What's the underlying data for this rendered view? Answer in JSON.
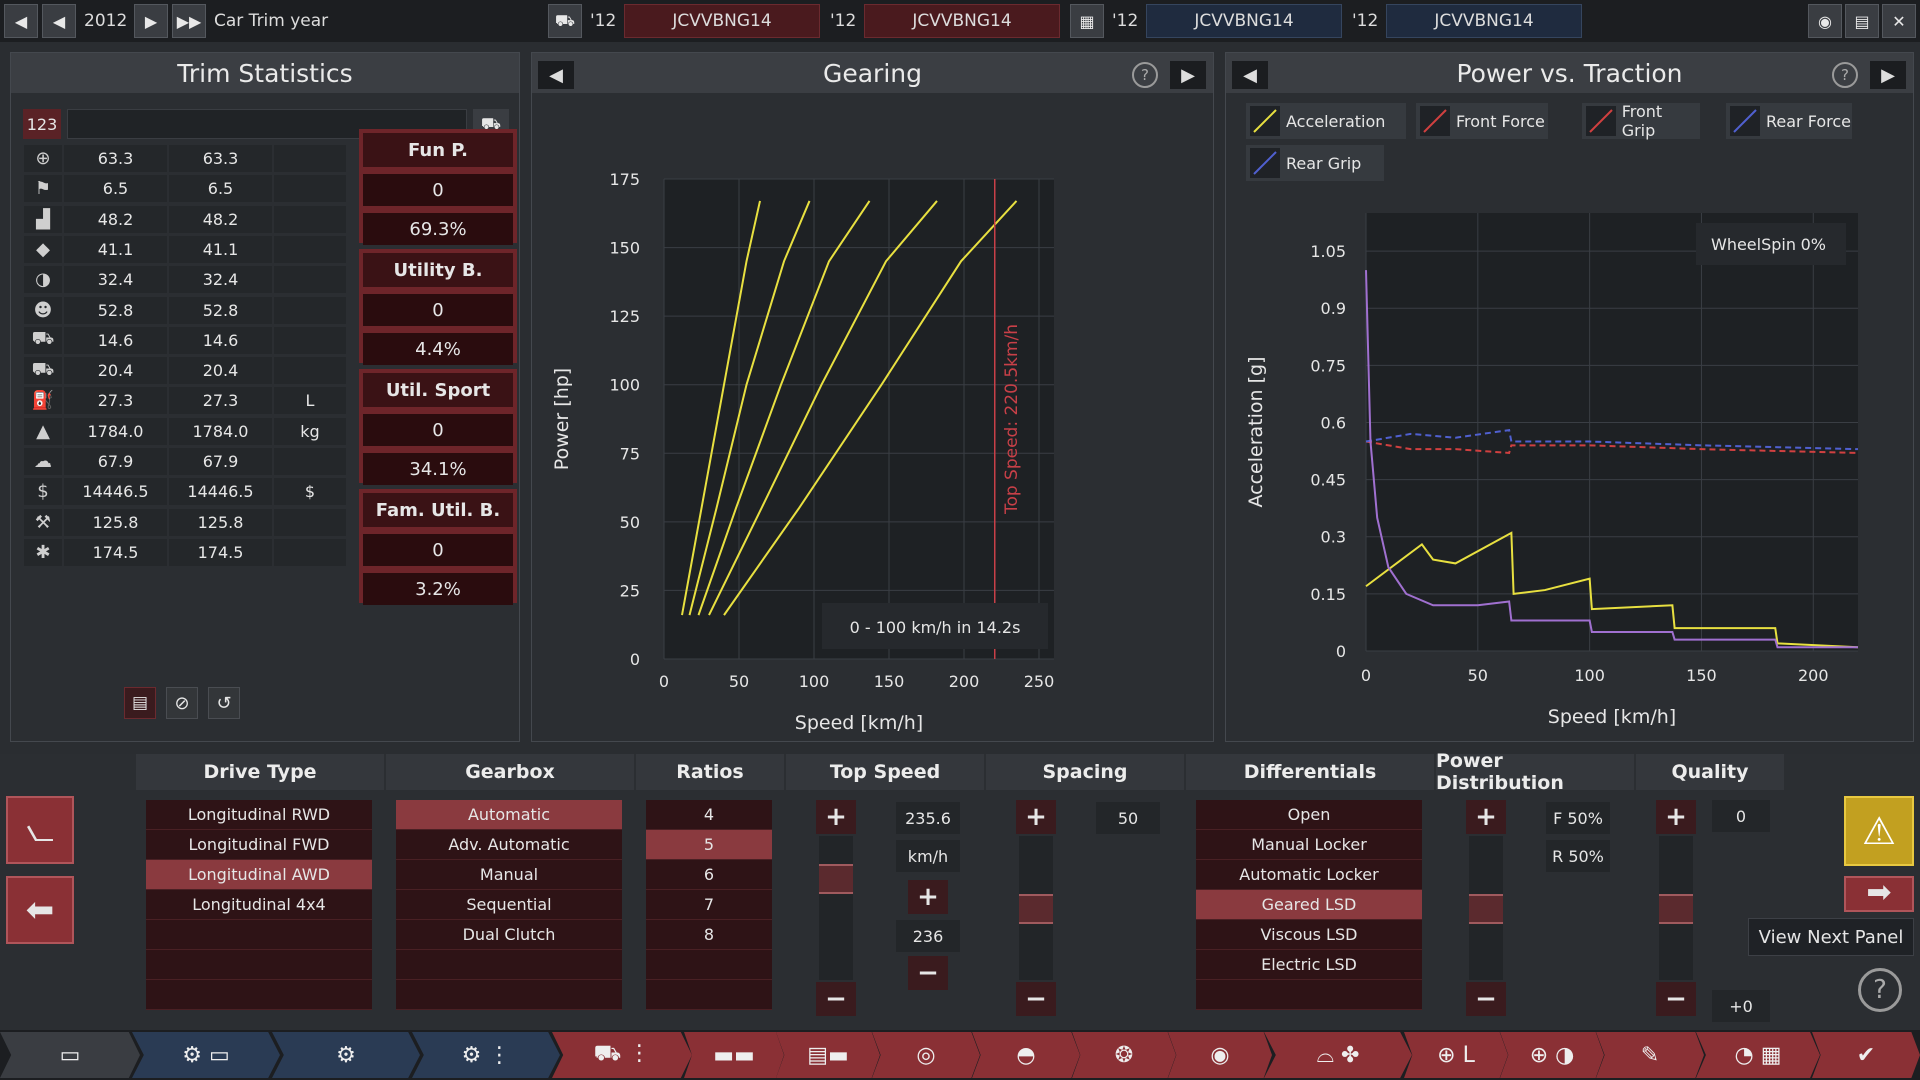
{
  "topbar": {
    "year": "2012",
    "label": "Car Trim year",
    "engines": [
      {
        "prefix": "'12",
        "name": "JCVVBNG14"
      },
      {
        "prefix": "'12",
        "name": "JCVVBNG14"
      },
      {
        "prefix": "'12",
        "name": "JCVVBNG14"
      },
      {
        "prefix": "'12",
        "name": "JCVVBNG14"
      }
    ]
  },
  "trim_stats": {
    "title": "Trim Statistics",
    "badge": "123",
    "rows": [
      {
        "icon": "steering-wheel-icon",
        "v1": "63.3",
        "v2": "63.3",
        "unit": ""
      },
      {
        "icon": "checkered-flag-icon",
        "v1": "6.5",
        "v2": "6.5",
        "unit": ""
      },
      {
        "icon": "seat-icon",
        "v1": "48.2",
        "v2": "48.2",
        "unit": ""
      },
      {
        "icon": "diamond-icon",
        "v1": "41.1",
        "v2": "41.1",
        "unit": ""
      },
      {
        "icon": "safety-icon",
        "v1": "32.4",
        "v2": "32.4",
        "unit": ""
      },
      {
        "icon": "passengers-icon",
        "v1": "52.8",
        "v2": "52.8",
        "unit": ""
      },
      {
        "icon": "cargo-car-icon",
        "v1": "14.6",
        "v2": "14.6",
        "unit": ""
      },
      {
        "icon": "offroad-car-icon",
        "v1": "20.4",
        "v2": "20.4",
        "unit": ""
      },
      {
        "icon": "fuel-can-icon",
        "v1": "27.3",
        "v2": "27.3",
        "unit": "L"
      },
      {
        "icon": "weight-icon",
        "v1": "1784.0",
        "v2": "1784.0",
        "unit": "kg"
      },
      {
        "icon": "emissions-icon",
        "v1": "67.9",
        "v2": "67.9",
        "unit": ""
      },
      {
        "icon": "money-bag-icon",
        "v1": "14446.5",
        "v2": "14446.5",
        "unit": "$"
      },
      {
        "icon": "service-icon",
        "v1": "125.8",
        "v2": "125.8",
        "unit": ""
      },
      {
        "icon": "wrench-icon",
        "v1": "174.5",
        "v2": "174.5",
        "unit": ""
      }
    ],
    "scores": [
      {
        "label": "Fun P.",
        "value": "0",
        "pct": "69.3%"
      },
      {
        "label": "Utility B.",
        "value": "0",
        "pct": "4.4%"
      },
      {
        "label": "Util. Sport",
        "value": "0",
        "pct": "34.1%"
      },
      {
        "label": "Fam. Util. B.",
        "value": "0",
        "pct": "3.2%"
      }
    ]
  },
  "gearing": {
    "title": "Gearing",
    "xlabel": "Speed [km/h]",
    "ylabel": "Power [hp]",
    "top_speed_label": "Top Speed: 220.5km/h",
    "accel_label": "0 - 100 km/h in 14.2s"
  },
  "traction": {
    "title": "Power vs. Traction",
    "xlabel": "Speed [km/h]",
    "ylabel": "Acceleration [g]",
    "wheelspin_label": "WheelSpin",
    "wheelspin_value": "0%",
    "legend": [
      {
        "name": "Acceleration",
        "color": "#e8e040"
      },
      {
        "name": "Front Force",
        "color": "#d04040"
      },
      {
        "name": "Front Grip",
        "color": "#d04040"
      },
      {
        "name": "Rear Force",
        "color": "#5060d0"
      },
      {
        "name": "Rear Grip",
        "color": "#5060d0"
      }
    ]
  },
  "chart_data": [
    {
      "type": "line",
      "title": "Gearing",
      "xlabel": "Speed [km/h]",
      "ylabel": "Power [hp]",
      "xlim": [
        0,
        260
      ],
      "ylim": [
        0,
        175
      ],
      "xticks": [
        0,
        50,
        100,
        150,
        200,
        250
      ],
      "yticks": [
        0,
        25,
        50,
        75,
        100,
        125,
        150,
        175
      ],
      "series": [
        {
          "x": [
            12,
            25,
            40,
            55,
            64
          ],
          "y": [
            16,
            55,
            100,
            145,
            167
          ]
        },
        {
          "x": [
            17,
            35,
            55,
            80,
            97
          ],
          "y": [
            16,
            55,
            100,
            145,
            167
          ]
        },
        {
          "x": [
            23,
            48,
            78,
            110,
            137
          ],
          "y": [
            16,
            55,
            100,
            145,
            167
          ]
        },
        {
          "x": [
            30,
            65,
            105,
            148,
            182
          ],
          "y": [
            16,
            55,
            100,
            145,
            167
          ]
        },
        {
          "x": [
            40,
            90,
            145,
            198,
            235
          ],
          "y": [
            16,
            55,
            100,
            145,
            167
          ]
        }
      ],
      "top_speed": 220.5,
      "grid": true
    },
    {
      "type": "line",
      "title": "Power vs. Traction",
      "xlabel": "Speed [km/h]",
      "ylabel": "Acceleration [g]",
      "xlim": [
        0,
        220
      ],
      "ylim": [
        0,
        1.15
      ],
      "xticks": [
        0,
        50,
        100,
        150,
        200
      ],
      "yticks": [
        0,
        0.15,
        0.3,
        0.45,
        0.6,
        0.75,
        0.9,
        1.05
      ],
      "series": [
        {
          "name": "Acceleration",
          "x": [
            0,
            25,
            30,
            40,
            65,
            66,
            80,
            100,
            101,
            137,
            138,
            183,
            184,
            220
          ],
          "y": [
            0.17,
            0.28,
            0.24,
            0.23,
            0.31,
            0.15,
            0.16,
            0.19,
            0.11,
            0.12,
            0.06,
            0.06,
            0.02,
            0.01
          ]
        },
        {
          "name": "Front Force",
          "x": [
            0,
            20,
            40,
            64,
            65,
            100,
            150,
            220
          ],
          "y": [
            0.55,
            0.53,
            0.53,
            0.52,
            0.54,
            0.54,
            0.53,
            0.52
          ]
        },
        {
          "name": "Rear Force",
          "x": [
            0,
            20,
            40,
            64,
            65,
            100,
            150,
            220
          ],
          "y": [
            0.55,
            0.57,
            0.56,
            0.58,
            0.55,
            0.55,
            0.54,
            0.53
          ]
        },
        {
          "name": "Rear Grip",
          "x": [
            0,
            2,
            5,
            10,
            18,
            30,
            50,
            64,
            65,
            100,
            101,
            137,
            138,
            183,
            184,
            220
          ],
          "y": [
            1.0,
            0.55,
            0.35,
            0.22,
            0.15,
            0.12,
            0.12,
            0.13,
            0.08,
            0.08,
            0.05,
            0.05,
            0.03,
            0.03,
            0.01,
            0.01
          ]
        }
      ],
      "grid": true
    }
  ],
  "bottom": {
    "drive_type": {
      "title": "Drive Type",
      "items": [
        "Longitudinal RWD",
        "Longitudinal FWD",
        "Longitudinal AWD",
        "Longitudinal 4x4"
      ],
      "selected": 2
    },
    "gearbox": {
      "title": "Gearbox",
      "items": [
        "Automatic",
        "Adv. Automatic",
        "Manual",
        "Sequential",
        "Dual Clutch"
      ],
      "selected": 0
    },
    "ratios": {
      "title": "Ratios",
      "items": [
        "4",
        "5",
        "6",
        "7",
        "8"
      ],
      "selected": 1
    },
    "top_speed": {
      "title": "Top Speed",
      "value": "235.6",
      "unit": "km/h",
      "target": "236"
    },
    "spacing": {
      "title": "Spacing",
      "value": "50"
    },
    "differentials": {
      "title": "Differentials",
      "items": [
        "Open",
        "Manual Locker",
        "Automatic Locker",
        "Geared LSD",
        "Viscous LSD",
        "Electric LSD"
      ],
      "selected": 3
    },
    "power_distribution": {
      "title": "Power Distribution",
      "front": "F 50%",
      "rear": "R 50%"
    },
    "quality": {
      "title": "Quality",
      "value": "0",
      "bonus": "+0"
    },
    "tooltip": "View Next Panel"
  }
}
